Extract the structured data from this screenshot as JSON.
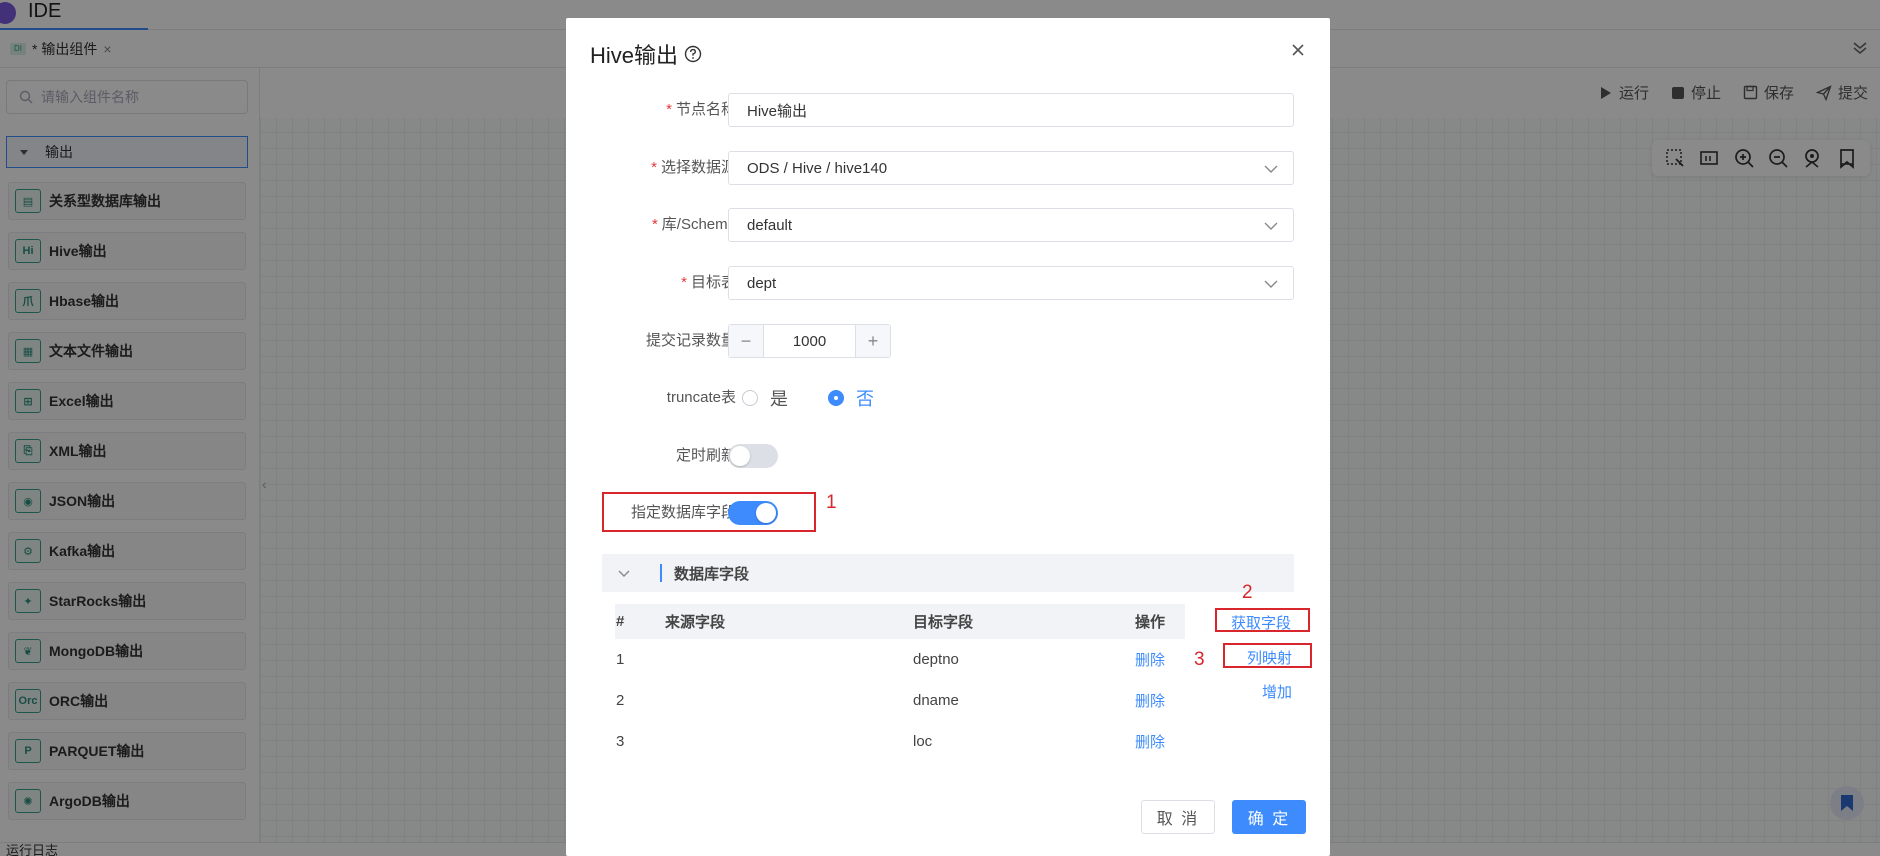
{
  "app": {
    "title": "IDE"
  },
  "tab": {
    "icon_text": "DI",
    "label": "* 输出组件",
    "close": "×"
  },
  "sidebar": {
    "search_placeholder": "请输入组件名称",
    "group_label": "输出",
    "items": [
      {
        "icon": "▤",
        "label": "关系型数据库输出"
      },
      {
        "icon": "Hi",
        "label": "Hive输出"
      },
      {
        "icon": "爪",
        "label": "Hbase输出"
      },
      {
        "icon": "▦",
        "label": "文本文件输出"
      },
      {
        "icon": "⊞",
        "label": "Excel输出"
      },
      {
        "icon": "⎘",
        "label": "XML输出"
      },
      {
        "icon": "◉",
        "label": "JSON输出"
      },
      {
        "icon": "⚙",
        "label": "Kafka输出"
      },
      {
        "icon": "✦",
        "label": "StarRocks输出"
      },
      {
        "icon": "❦",
        "label": "MongoDB输出"
      },
      {
        "icon": "Orc",
        "label": "ORC输出"
      },
      {
        "icon": "P",
        "label": "PARQUET输出"
      },
      {
        "icon": "✺",
        "label": "ArgoDB输出"
      }
    ]
  },
  "toolbar": {
    "run": "运行",
    "stop": "停止",
    "save": "保存",
    "submit": "提交"
  },
  "bottom": {
    "log_label": "运行日志"
  },
  "dialog": {
    "title": "Hive输出",
    "fields": {
      "node_name": {
        "label": "节点名称",
        "value": "Hive输出"
      },
      "datasource": {
        "label": "选择数据源",
        "value": "ODS / Hive / hive140"
      },
      "schema": {
        "label": "库/Schema",
        "value": "default"
      },
      "target_table": {
        "label": "目标表",
        "value": "dept"
      },
      "commit_count": {
        "label": "提交记录数量",
        "value": "1000"
      },
      "truncate": {
        "label": "truncate表",
        "options": [
          "是",
          "否"
        ],
        "selected": "否"
      },
      "timed_refresh": {
        "label": "定时刷新",
        "on": false
      },
      "specify_fields": {
        "label": "指定数据库字段",
        "on": true
      }
    },
    "section_title": "数据库字段",
    "table": {
      "headers": [
        "#",
        "来源字段",
        "目标字段",
        "操作"
      ],
      "rows": [
        {
          "index": "1",
          "source": "",
          "target": "deptno",
          "action": "删除"
        },
        {
          "index": "2",
          "source": "",
          "target": "dname",
          "action": "删除"
        },
        {
          "index": "3",
          "source": "",
          "target": "loc",
          "action": "删除"
        }
      ]
    },
    "actions": {
      "fetch_fields": "获取字段",
      "column_mapping": "列映射",
      "add": "增加"
    },
    "annotations": [
      "1",
      "2",
      "3"
    ],
    "buttons": {
      "cancel": "取 消",
      "ok": "确 定"
    }
  },
  "colors": {
    "primary": "#3d8bfd",
    "annotation": "#d8262c",
    "overlay": "rgba(0,0,0,0.46)"
  }
}
